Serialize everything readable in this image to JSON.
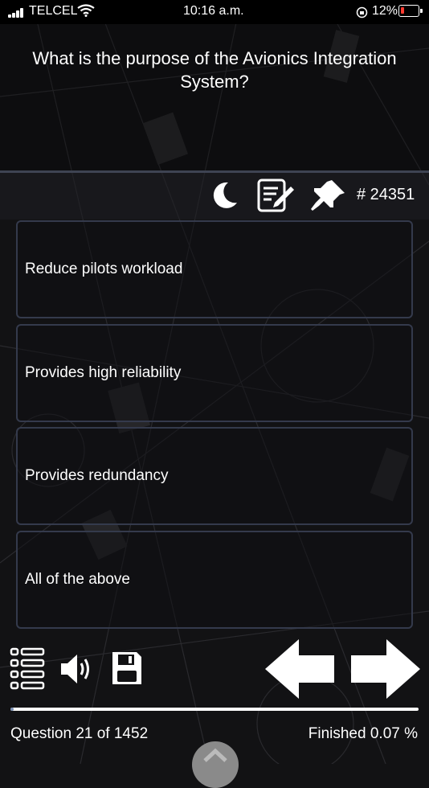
{
  "status_bar": {
    "carrier": "TELCEL",
    "time": "10:16 a.m.",
    "battery_percent": "12%",
    "battery_level": 0.12
  },
  "question": {
    "text": "What is the purpose of the Avionics Integration System?",
    "id_label": "# 24351"
  },
  "answers": [
    {
      "label": "Reduce pilots workload"
    },
    {
      "label": "Provides high reliability"
    },
    {
      "label": "Provides redundancy"
    },
    {
      "label": "All of the above"
    }
  ],
  "footer": {
    "question_counter": "Question 21 of 1452",
    "finished_label": "Finished 0.07 %",
    "progress_fraction": 0.0007
  },
  "icons": {
    "night_mode": "moon-icon",
    "notes": "edit-note-icon",
    "pin": "pin-icon",
    "list": "list-icon",
    "audio": "speaker-icon",
    "save": "floppy-disk-icon",
    "prev": "arrow-left-icon",
    "next": "arrow-right-icon"
  },
  "colors": {
    "background": "#121214",
    "border": "#343a4c",
    "progress_fill": "#7a8fb3",
    "battery_low": "#ff3b30"
  }
}
